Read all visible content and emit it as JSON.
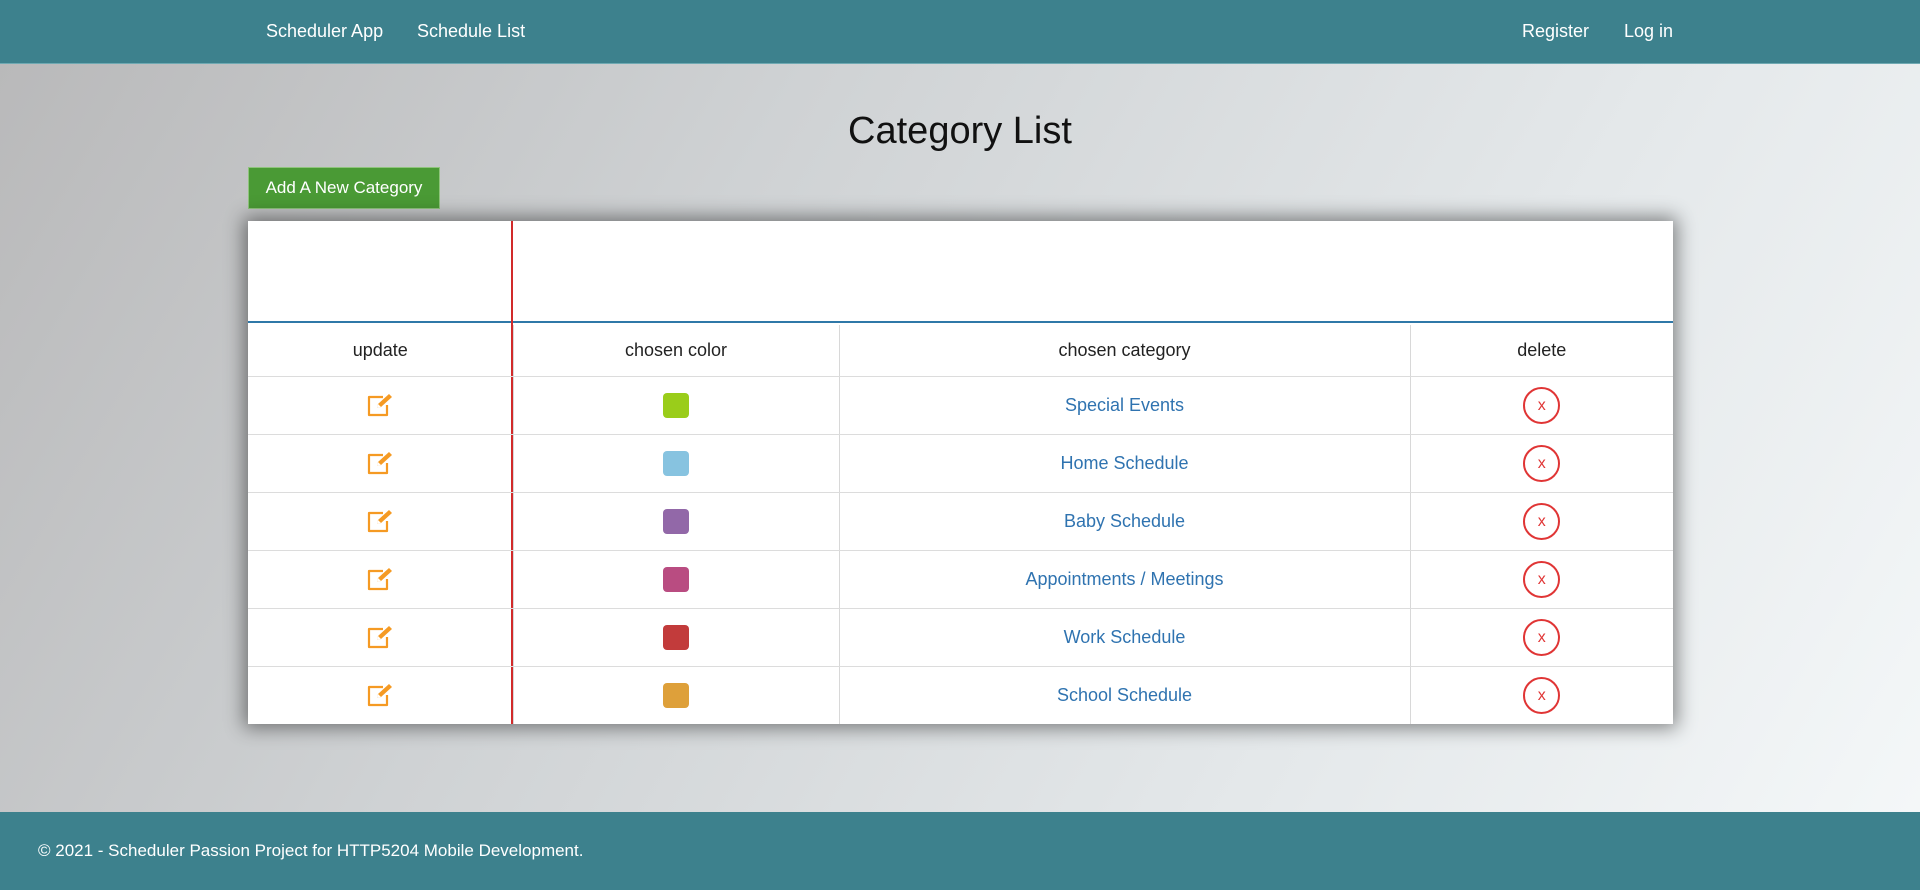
{
  "nav": {
    "brand": "Scheduler App",
    "schedule_list": "Schedule List",
    "register": "Register",
    "login": "Log in"
  },
  "page": {
    "title": "Category List",
    "add_button": "Add A New Category"
  },
  "table": {
    "headers": [
      "update",
      "chosen color",
      "chosen category",
      "delete"
    ],
    "rows": [
      {
        "color": "#9acd1a",
        "category": "Special Events",
        "delete_label": "x"
      },
      {
        "color": "#87c3e0",
        "category": "Home Schedule",
        "delete_label": "x"
      },
      {
        "color": "#9268a8",
        "category": "Baby Schedule",
        "delete_label": "x"
      },
      {
        "color": "#b94c81",
        "category": "Appointments / Meetings",
        "delete_label": "x"
      },
      {
        "color": "#c23b3b",
        "category": "Work Schedule",
        "delete_label": "x"
      },
      {
        "color": "#dea03a",
        "category": "School Schedule",
        "delete_label": "x"
      }
    ],
    "edit_icon": "edit-pencil-icon",
    "edit_icon_color": "#f59a23"
  },
  "footer": {
    "text": "© 2021 - Scheduler Passion Project for HTTP5204 Mobile Development."
  }
}
